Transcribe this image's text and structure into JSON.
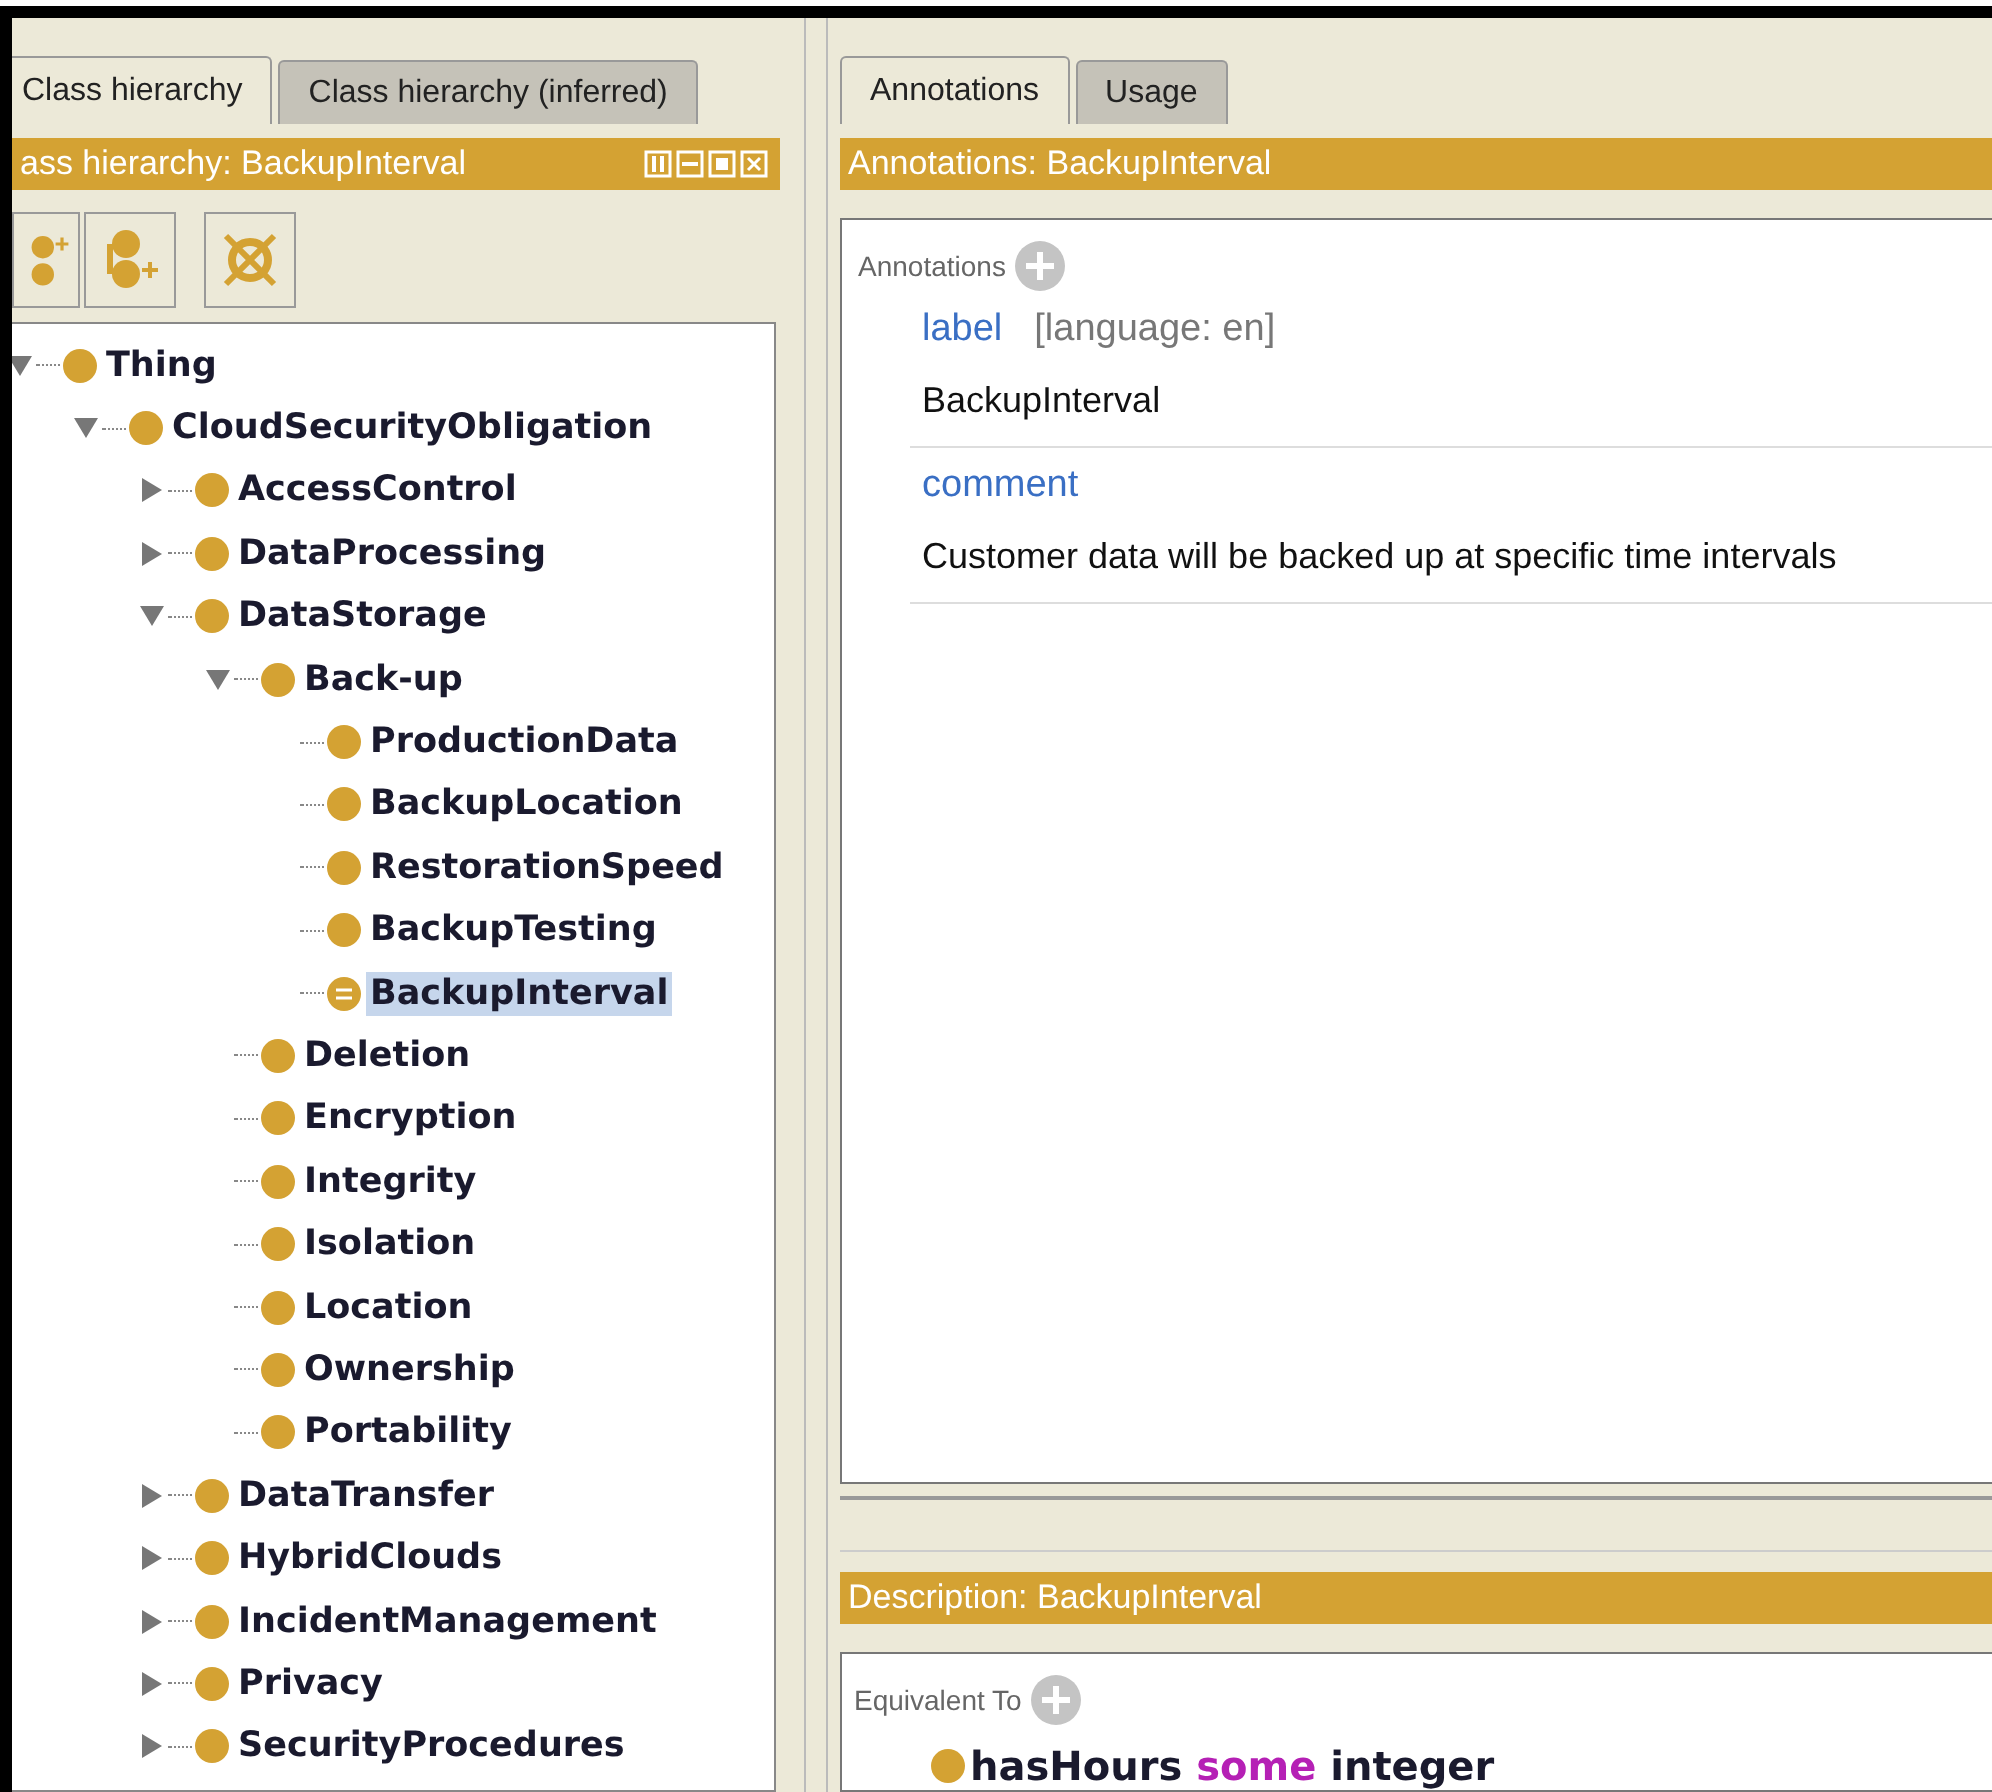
{
  "left_panel": {
    "tabs": [
      {
        "label": "Class hierarchy",
        "selected": true
      },
      {
        "label": "Class hierarchy (inferred)",
        "selected": false
      }
    ],
    "header": "ass hierarchy: BackupInterval",
    "tree": [
      {
        "label": "Thing",
        "kind": "branch",
        "expanded": true,
        "selected": false,
        "children": [
          {
            "label": "CloudSecurityObligation",
            "kind": "branch",
            "expanded": true,
            "selected": false,
            "children": [
              {
                "label": "AccessControl",
                "kind": "branch",
                "expanded": false,
                "selected": false
              },
              {
                "label": "DataProcessing",
                "kind": "branch",
                "expanded": false,
                "selected": false
              },
              {
                "label": "DataStorage",
                "kind": "branch",
                "expanded": true,
                "selected": false,
                "children": [
                  {
                    "label": "Back-up",
                    "kind": "branch",
                    "expanded": true,
                    "selected": false,
                    "children": [
                      {
                        "label": "ProductionData",
                        "kind": "leaf",
                        "selected": false
                      },
                      {
                        "label": "BackupLocation",
                        "kind": "leaf",
                        "selected": false
                      },
                      {
                        "label": "RestorationSpeed",
                        "kind": "leaf",
                        "selected": false
                      },
                      {
                        "label": "BackupTesting",
                        "kind": "leaf",
                        "selected": false
                      },
                      {
                        "label": "BackupInterval",
                        "kind": "leaf",
                        "selected": true
                      }
                    ]
                  },
                  {
                    "label": "Deletion",
                    "kind": "leaf",
                    "selected": false
                  },
                  {
                    "label": "Encryption",
                    "kind": "leaf",
                    "selected": false
                  },
                  {
                    "label": "Integrity",
                    "kind": "leaf",
                    "selected": false
                  },
                  {
                    "label": "Isolation",
                    "kind": "leaf",
                    "selected": false
                  },
                  {
                    "label": "Location",
                    "kind": "leaf",
                    "selected": false
                  },
                  {
                    "label": "Ownership",
                    "kind": "leaf",
                    "selected": false
                  },
                  {
                    "label": "Portability",
                    "kind": "leaf",
                    "selected": false
                  }
                ]
              },
              {
                "label": "DataTransfer",
                "kind": "branch",
                "expanded": false,
                "selected": false
              },
              {
                "label": "HybridClouds",
                "kind": "branch",
                "expanded": false,
                "selected": false
              },
              {
                "label": "IncidentManagement",
                "kind": "branch",
                "expanded": false,
                "selected": false
              },
              {
                "label": "Privacy",
                "kind": "branch",
                "expanded": false,
                "selected": false
              },
              {
                "label": "SecurityProcedures",
                "kind": "branch",
                "expanded": false,
                "selected": false
              }
            ]
          }
        ]
      }
    ]
  },
  "right_panel": {
    "tabs": [
      {
        "label": "Annotations",
        "selected": true
      },
      {
        "label": "Usage",
        "selected": false
      }
    ],
    "annotations_header": "Annotations: BackupInterval",
    "annotations_title": "Annotations",
    "annotations": [
      {
        "property": "label",
        "qualifier": "[language: en]",
        "value": "BackupInterval"
      },
      {
        "property": "comment",
        "value": "Customer data will be backed up at specific time intervals"
      }
    ],
    "description_header": "Description: BackupInterval",
    "equivalent_title": "Equivalent To",
    "equivalent_to": [
      {
        "kind": "class",
        "text": "hasHours"
      },
      {
        "kind": "keyword",
        "text": "some"
      },
      {
        "kind": "class",
        "text": "integer"
      }
    ]
  }
}
